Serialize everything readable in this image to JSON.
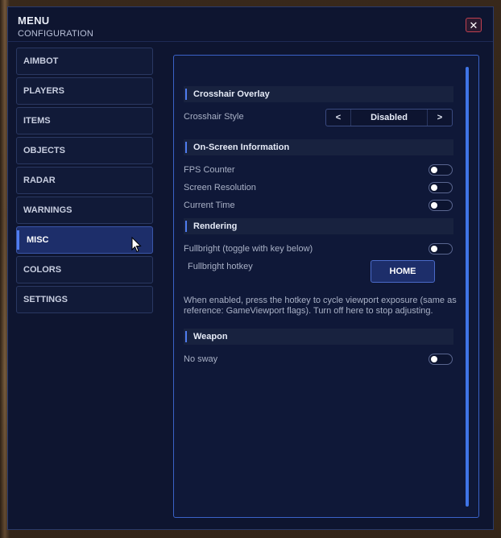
{
  "header": {
    "title": "MENU",
    "subtitle": "CONFIGURATION",
    "close_label": "✕"
  },
  "nav": {
    "items": [
      {
        "label": "AIMBOT"
      },
      {
        "label": "PLAYERS"
      },
      {
        "label": "ITEMS"
      },
      {
        "label": "OBJECTS"
      },
      {
        "label": "RADAR"
      },
      {
        "label": "WARNINGS"
      },
      {
        "label": "MISC",
        "active": true
      },
      {
        "label": "COLORS"
      },
      {
        "label": "SETTINGS"
      }
    ]
  },
  "content": {
    "crosshair": {
      "section": "Crosshair Overlay",
      "style_label": "Crosshair Style",
      "style_value": "Disabled",
      "prev": "<",
      "next": ">"
    },
    "osi": {
      "section": "On-Screen Information",
      "fps_label": "FPS Counter",
      "fps_on": false,
      "res_label": "Screen Resolution",
      "res_on": false,
      "time_label": "Current Time",
      "time_on": false
    },
    "rendering": {
      "section": "Rendering",
      "fullbright_label": "Fullbright (toggle with key below)",
      "fullbright_on": false,
      "hotkey_label": "Fullbright hotkey",
      "hotkey_value": "HOME",
      "note": "When enabled, press the hotkey to cycle viewport exposure (same as reference: GameViewport flags). Turn off here to stop adjusting."
    },
    "weapon": {
      "section": "Weapon",
      "nosway_label": "No sway",
      "nosway_on": false
    }
  },
  "colors": {
    "accent": "#4f7cf0",
    "panel": "#0e1530",
    "border": "#3a62c8"
  }
}
